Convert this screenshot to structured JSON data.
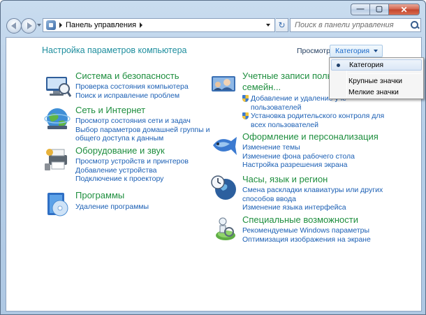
{
  "window": {
    "minimize_glyph": "—",
    "maximize_glyph": "▢",
    "close_glyph": "✕"
  },
  "address": {
    "breadcrumb": "Панель управления",
    "refresh_glyph": "↻"
  },
  "search": {
    "placeholder": "Поиск в панели управления"
  },
  "header": {
    "title": "Настройка параметров компьютера",
    "view_label": "Просмотр:",
    "view_value": "Категория"
  },
  "view_menu": {
    "items": [
      "Категория",
      "Крупные значки",
      "Мелкие значки"
    ],
    "selected": "Категория"
  },
  "categories": {
    "system": {
      "title": "Система и безопасность",
      "links": [
        "Проверка состояния компьютера",
        "Поиск и исправление проблем"
      ]
    },
    "network": {
      "title": "Сеть и Интернет",
      "links": [
        "Просмотр состояния сети и задач",
        "Выбор параметров домашней группы и",
        "общего доступа к данным"
      ]
    },
    "hardware": {
      "title": "Оборудование и звук",
      "links": [
        "Просмотр устройств и принтеров",
        "Добавление устройства",
        "Подключение к проектору"
      ]
    },
    "programs": {
      "title": "Программы",
      "links": [
        "Удаление программы"
      ]
    },
    "accounts": {
      "title_line1": "Учетные записи пользова",
      "title_line2": "семейн...",
      "links": [
        "Добавление и удаление уче",
        "пользователей",
        "Установка родительского контроля для",
        "всех пользователей"
      ]
    },
    "appearance": {
      "title": "Оформление и персонализация",
      "links": [
        "Изменение темы",
        "Изменение фона рабочего стола",
        "Настройка разрешения экрана"
      ]
    },
    "clock": {
      "title": "Часы, язык и регион",
      "links": [
        "Смена раскладки клавиатуры или других",
        "способов ввода",
        "Изменение языка интерфейса"
      ]
    },
    "ease": {
      "title": "Специальные возможности",
      "links": [
        "Рекомендуемые Windows параметры",
        "Оптимизация изображения на экране"
      ]
    }
  },
  "colors": {
    "title_green": "#1e8e3e",
    "link_blue": "#1b5fb4",
    "header_teal": "#1e8e9e"
  }
}
